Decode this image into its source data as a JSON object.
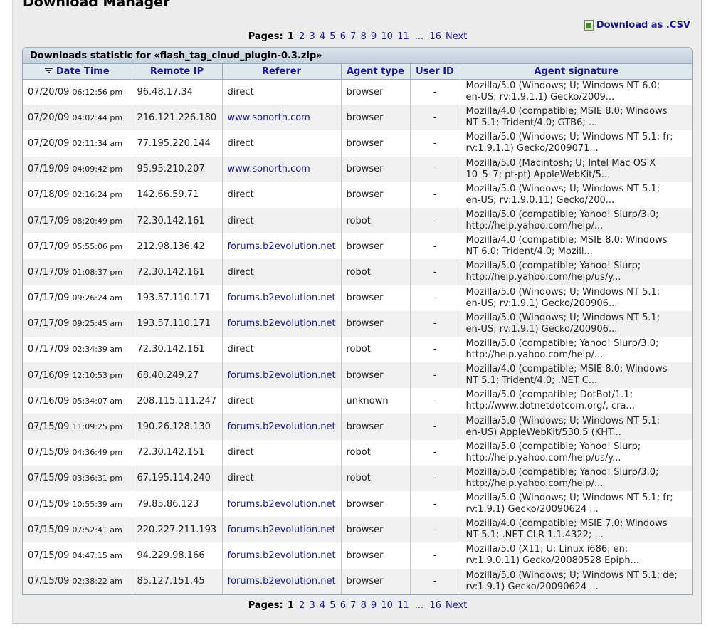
{
  "page": {
    "title": "Download Manager"
  },
  "actions": {
    "csv_label": "Download as .CSV"
  },
  "pagination": {
    "label": "Pages:",
    "current": "1",
    "pages": [
      "2",
      "3",
      "4",
      "5",
      "6",
      "7",
      "8",
      "9",
      "10",
      "11"
    ],
    "ellipsis": "...",
    "last": "16",
    "next": "Next"
  },
  "table": {
    "caption": "Downloads statistic for «flash_tag_cloud_plugin-0.3.zip»",
    "columns": [
      "Date Time",
      "Remote IP",
      "Referer",
      "Agent type",
      "User ID",
      "Agent signature"
    ],
    "rows": [
      {
        "date": "07/20/09",
        "time": "06:12:56 pm",
        "ip": "96.48.17.34",
        "referer": "direct",
        "agent": "browser",
        "uid": "-",
        "sig1": "Mozilla/5.0 (Windows; U; Windows NT 6.0;",
        "sig2": "en-US; rv:1.9.1.1) Gecko/2009..."
      },
      {
        "date": "07/20/09",
        "time": "04:02:44 pm",
        "ip": "216.121.226.180",
        "referer": "www.sonorth.com",
        "agent": "browser",
        "uid": "-",
        "sig1": "Mozilla/4.0 (compatible; MSIE 8.0; Windows",
        "sig2": "NT 5.1; Trident/4.0; GTB6; ..."
      },
      {
        "date": "07/20/09",
        "time": "02:11:34 am",
        "ip": "77.195.220.144",
        "referer": "direct",
        "agent": "browser",
        "uid": "-",
        "sig1": "Mozilla/5.0 (Windows; U; Windows NT 5.1; fr;",
        "sig2": "rv:1.9.1.1) Gecko/2009071..."
      },
      {
        "date": "07/19/09",
        "time": "04:09:42 pm",
        "ip": "95.95.210.207",
        "referer": "www.sonorth.com",
        "agent": "browser",
        "uid": "-",
        "sig1": "Mozilla/5.0 (Macintosh; U; Intel Mac OS X",
        "sig2": "10_5_7; pt-pt) AppleWebKit/5..."
      },
      {
        "date": "07/18/09",
        "time": "02:16:24 pm",
        "ip": "142.66.59.71",
        "referer": "direct",
        "agent": "browser",
        "uid": "-",
        "sig1": "Mozilla/5.0 (Windows; U; Windows NT 5.1;",
        "sig2": "en-US; rv:1.9.0.11) Gecko/200..."
      },
      {
        "date": "07/17/09",
        "time": "08:20:49 pm",
        "ip": "72.30.142.161",
        "referer": "direct",
        "agent": "robot",
        "uid": "-",
        "sig1": "Mozilla/5.0 (compatible; Yahoo! Slurp/3.0;",
        "sig2": "http://help.yahoo.com/help/..."
      },
      {
        "date": "07/17/09",
        "time": "05:55:06 pm",
        "ip": "212.98.136.42",
        "referer": "forums.b2evolution.net",
        "agent": "browser",
        "uid": "-",
        "sig1": "Mozilla/4.0 (compatible; MSIE 8.0; Windows",
        "sig2": "NT 6.0; Trident/4.0; Mozill..."
      },
      {
        "date": "07/17/09",
        "time": "01:08:37 pm",
        "ip": "72.30.142.161",
        "referer": "direct",
        "agent": "robot",
        "uid": "-",
        "sig1": "Mozilla/5.0 (compatible; Yahoo! Slurp;",
        "sig2": "http://help.yahoo.com/help/us/y..."
      },
      {
        "date": "07/17/09",
        "time": "09:26:24 am",
        "ip": "193.57.110.171",
        "referer": "forums.b2evolution.net",
        "agent": "browser",
        "uid": "-",
        "sig1": "Mozilla/5.0 (Windows; U; Windows NT 5.1;",
        "sig2": "en-US; rv:1.9.1) Gecko/200906..."
      },
      {
        "date": "07/17/09",
        "time": "09:25:45 am",
        "ip": "193.57.110.171",
        "referer": "forums.b2evolution.net",
        "agent": "browser",
        "uid": "-",
        "sig1": "Mozilla/5.0 (Windows; U; Windows NT 5.1;",
        "sig2": "en-US; rv:1.9.1) Gecko/200906..."
      },
      {
        "date": "07/17/09",
        "time": "02:34:39 am",
        "ip": "72.30.142.161",
        "referer": "direct",
        "agent": "robot",
        "uid": "-",
        "sig1": "Mozilla/5.0 (compatible; Yahoo! Slurp/3.0;",
        "sig2": "http://help.yahoo.com/help/..."
      },
      {
        "date": "07/16/09",
        "time": "12:10:53 pm",
        "ip": "68.40.249.27",
        "referer": "forums.b2evolution.net",
        "agent": "browser",
        "uid": "-",
        "sig1": "Mozilla/4.0 (compatible; MSIE 8.0; Windows",
        "sig2": "NT 5.1; Trident/4.0; .NET C..."
      },
      {
        "date": "07/16/09",
        "time": "05:34:07 am",
        "ip": "208.115.111.247",
        "referer": "direct",
        "agent": "unknown",
        "uid": "-",
        "sig1": "Mozilla/5.0 (compatible; DotBot/1.1;",
        "sig2": "http://www.dotnetdotcom.org/, cra..."
      },
      {
        "date": "07/15/09",
        "time": "11:09:25 pm",
        "ip": "190.26.128.130",
        "referer": "forums.b2evolution.net",
        "agent": "browser",
        "uid": "-",
        "sig1": "Mozilla/5.0 (Windows; U; Windows NT 5.1;",
        "sig2": "en-US) AppleWebKit/530.5 (KHT..."
      },
      {
        "date": "07/15/09",
        "time": "04:36:49 pm",
        "ip": "72.30.142.151",
        "referer": "direct",
        "agent": "robot",
        "uid": "-",
        "sig1": "Mozilla/5.0 (compatible; Yahoo! Slurp;",
        "sig2": "http://help.yahoo.com/help/us/y..."
      },
      {
        "date": "07/15/09",
        "time": "03:36:31 pm",
        "ip": "67.195.114.240",
        "referer": "direct",
        "agent": "robot",
        "uid": "-",
        "sig1": "Mozilla/5.0 (compatible; Yahoo! Slurp/3.0;",
        "sig2": "http://help.yahoo.com/help/..."
      },
      {
        "date": "07/15/09",
        "time": "10:55:39 am",
        "ip": "79.85.86.123",
        "referer": "forums.b2evolution.net",
        "agent": "browser",
        "uid": "-",
        "sig1": "Mozilla/5.0 (Windows; U; Windows NT 5.1; fr;",
        "sig2": "rv:1.9.1) Gecko/20090624 ..."
      },
      {
        "date": "07/15/09",
        "time": "07:52:41 am",
        "ip": "220.227.211.193",
        "referer": "forums.b2evolution.net",
        "agent": "browser",
        "uid": "-",
        "sig1": "Mozilla/4.0 (compatible; MSIE 7.0; Windows",
        "sig2": "NT 5.1; .NET CLR 1.1.4322; ..."
      },
      {
        "date": "07/15/09",
        "time": "04:47:15 am",
        "ip": "94.229.98.166",
        "referer": "forums.b2evolution.net",
        "agent": "browser",
        "uid": "-",
        "sig1": "Mozilla/5.0 (X11; U; Linux i686; en;",
        "sig2": "rv:1.9.0.11) Gecko/20080528 Epiph..."
      },
      {
        "date": "07/15/09",
        "time": "02:38:22 am",
        "ip": "85.127.151.45",
        "referer": "forums.b2evolution.net",
        "agent": "browser",
        "uid": "-",
        "sig1": "Mozilla/5.0 (Windows; U; Windows NT 5.1; de;",
        "sig2": "rv:1.9.1) Gecko/20090624 ..."
      }
    ]
  },
  "icons": {
    "sort": "sort-desc-icon",
    "csv": "spreadsheet-icon"
  },
  "colors": {
    "link": "#1a1a9c",
    "header_bg": "#dfe7ef",
    "panel_bg": "#ececec",
    "row_alt": "#f0f0f0"
  }
}
